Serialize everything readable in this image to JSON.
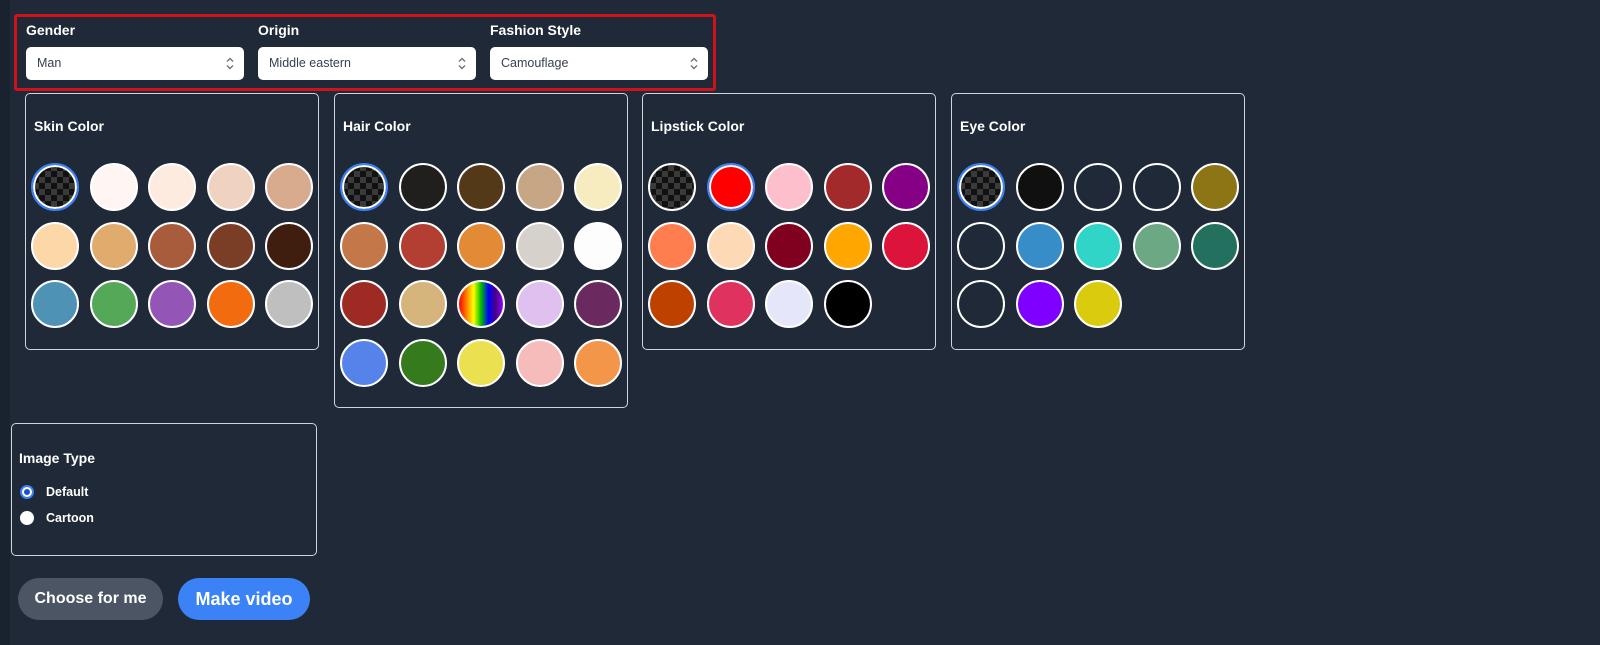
{
  "selects": [
    {
      "label": "Gender",
      "value": "Man"
    },
    {
      "label": "Origin",
      "value": "Middle eastern"
    },
    {
      "label": "Fashion Style",
      "value": "Camouflage"
    }
  ],
  "panels": {
    "skin": {
      "title": "Skin Color",
      "swatches": [
        {
          "color": "transparent",
          "selected": true
        },
        {
          "color": "#fff5f2"
        },
        {
          "color": "#fdebe0"
        },
        {
          "color": "#efd2c0"
        },
        {
          "color": "#d9ab8e"
        },
        {
          "color": "#fcd8a8"
        },
        {
          "color": "#e0ac6e"
        },
        {
          "color": "#a85c3c"
        },
        {
          "color": "#7a3d26"
        },
        {
          "color": "#3f1e10"
        },
        {
          "color": "#4e92b6"
        },
        {
          "color": "#55a858"
        },
        {
          "color": "#9356b6"
        },
        {
          "color": "#f26b0f"
        },
        {
          "color": "#bfbfbf"
        }
      ]
    },
    "hair": {
      "title": "Hair Color",
      "swatches": [
        {
          "color": "transparent",
          "selected": true
        },
        {
          "color": "#201f1e"
        },
        {
          "color": "#543919"
        },
        {
          "color": "#c7a686"
        },
        {
          "color": "#f6ecbf"
        },
        {
          "color": "#c4784a"
        },
        {
          "color": "#b23f32"
        },
        {
          "color": "#e28a36"
        },
        {
          "color": "#d6d1cb"
        },
        {
          "color": "#fdfdfd"
        },
        {
          "color": "#9d2b23"
        },
        {
          "color": "#d6b57c"
        },
        {
          "color": "rainbow"
        },
        {
          "color": "#dfc0ee"
        },
        {
          "color": "#6a2a5f"
        },
        {
          "color": "#5583ea"
        },
        {
          "color": "#357a1d"
        },
        {
          "color": "#ebe150"
        },
        {
          "color": "#f6bcbc"
        },
        {
          "color": "#f4964a"
        }
      ]
    },
    "lipstick": {
      "title": "Lipstick Color",
      "swatches": [
        {
          "color": "transparent"
        },
        {
          "color": "#ff0000",
          "selected": true
        },
        {
          "color": "#fcbfcb"
        },
        {
          "color": "#a32a2a"
        },
        {
          "color": "#850085"
        },
        {
          "color": "#fe7e50"
        },
        {
          "color": "#fdd9b5"
        },
        {
          "color": "#800020"
        },
        {
          "color": "#ffa600"
        },
        {
          "color": "#dc143c"
        },
        {
          "color": "#be4100"
        },
        {
          "color": "#e0325f"
        },
        {
          "color": "#e6e6fa"
        },
        {
          "color": "#000000"
        }
      ]
    },
    "eye": {
      "title": "Eye Color",
      "swatches": [
        {
          "color": "transparent",
          "selected": true
        },
        {
          "color": "#101010"
        },
        {
          "color": "#1f2937"
        },
        {
          "color": "#1f2937"
        },
        {
          "color": "#8d7516"
        },
        {
          "color": "#1f2937"
        },
        {
          "color": "#368dc7"
        },
        {
          "color": "#30d5c8"
        },
        {
          "color": "#6ca884"
        },
        {
          "color": "#24705f"
        },
        {
          "color": "#1f2937"
        },
        {
          "color": "#8000ff"
        },
        {
          "color": "#d9cc0f"
        }
      ]
    }
  },
  "image_type": {
    "title": "Image Type",
    "options": [
      {
        "label": "Default",
        "checked": true
      },
      {
        "label": "Cartoon",
        "checked": false
      }
    ]
  },
  "buttons": {
    "choose": "Choose for me",
    "make": "Make video"
  },
  "colors": {
    "background": "#1f2937",
    "highlight_border": "#d0121b",
    "primary_button": "#3b82f6",
    "secondary_button": "#4b5563",
    "selected_ring": "#3b82f6"
  }
}
